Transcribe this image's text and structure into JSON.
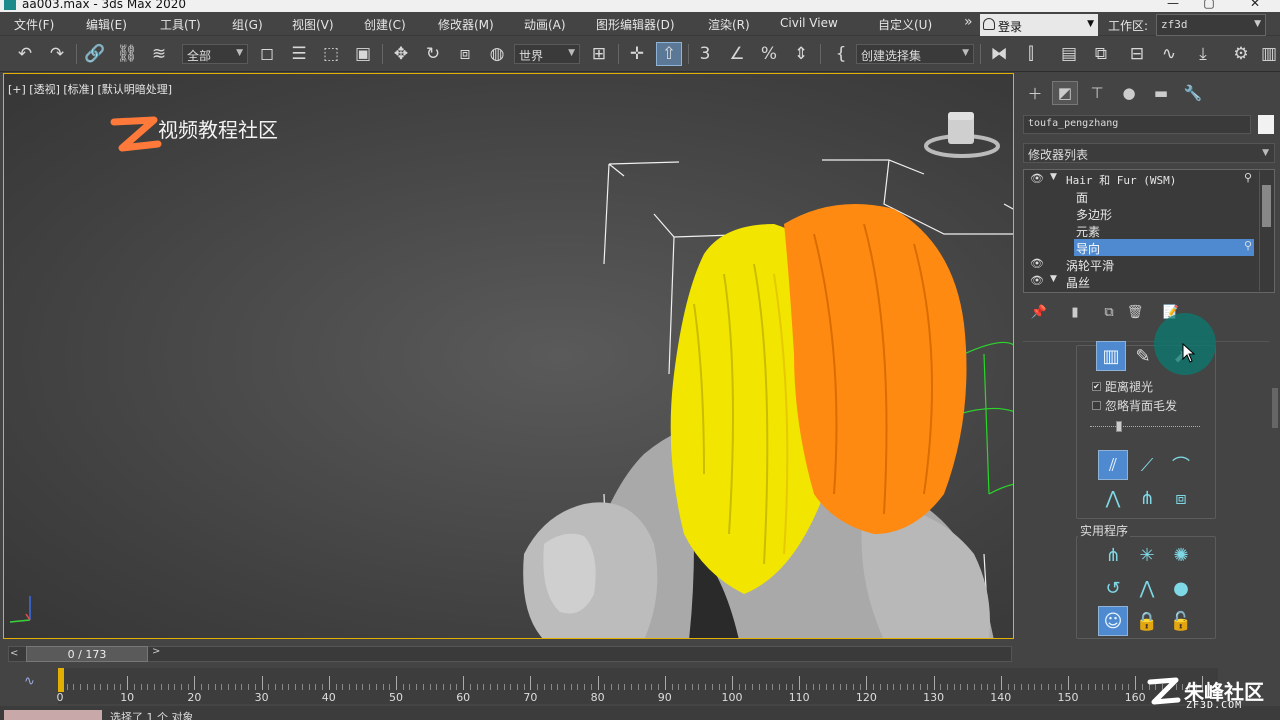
{
  "window": {
    "title": "aa003.max - 3ds Max 2020",
    "minimize": "—",
    "maximize": "▢",
    "close": "✕"
  },
  "menu": {
    "items": [
      "文件(F)",
      "编辑(E)",
      "工具(T)",
      "组(G)",
      "视图(V)",
      "创建(C)",
      "修改器(M)",
      "动画(A)",
      "图形编辑器(D)",
      "渲染(R)",
      "Civil View",
      "自定义(U)"
    ],
    "more": "»",
    "login": "登录",
    "workspace_label": "工作区:",
    "workspace_value": "zf3d"
  },
  "toolbar": {
    "selection_filter": "全部",
    "ref_coord": "世界",
    "named_selection": "创建选择集"
  },
  "viewport": {
    "label": "[+] [透视] [标准] [默认明暗处理]",
    "logo_text": "视频教程社区",
    "hair_colors": {
      "yellow": "#f2e600",
      "orange": "#ff8a12"
    }
  },
  "panel": {
    "object_name": "toufa_pengzhang",
    "modifier_list": "修改器列表",
    "stack": [
      {
        "label": "Hair 和 Fur (WSM)",
        "level": 0,
        "eye": true,
        "expanded": true
      },
      {
        "label": "面",
        "level": 1
      },
      {
        "label": "多边形",
        "level": 1
      },
      {
        "label": "元素",
        "level": 1
      },
      {
        "label": "导向",
        "level": 1,
        "selected": true
      },
      {
        "label": "涡轮平滑",
        "level": 0,
        "eye": true
      },
      {
        "label": "晶丝",
        "level": 0,
        "eye": true,
        "expanded": true
      }
    ],
    "checkbox_distance": "距离褪光",
    "checkbox_distance_checked": true,
    "checkbox_ignore_back": "忽略背面毛发",
    "checkbox_ignore_back_checked": false,
    "slider_level": 0.25,
    "utilities_title": "实用程序"
  },
  "timeline": {
    "frame_display": "0 / 173",
    "prev": "<",
    "next": ">",
    "current_frame": 0,
    "total_frames": 173,
    "tick_labels": [
      "0",
      "10",
      "20",
      "30",
      "40",
      "50",
      "60",
      "70",
      "80",
      "90",
      "100",
      "110",
      "120",
      "130",
      "140",
      "150",
      "160"
    ]
  },
  "status": {
    "selected": "选择了 1 个 对象"
  },
  "watermark": {
    "text": "朱峰社区",
    "sub": "ZF3D.COM"
  },
  "colors": {
    "accent_blue": "#4f8ad0",
    "viewport_border": "#e1b000",
    "cursor_ring": "#0a786e"
  }
}
